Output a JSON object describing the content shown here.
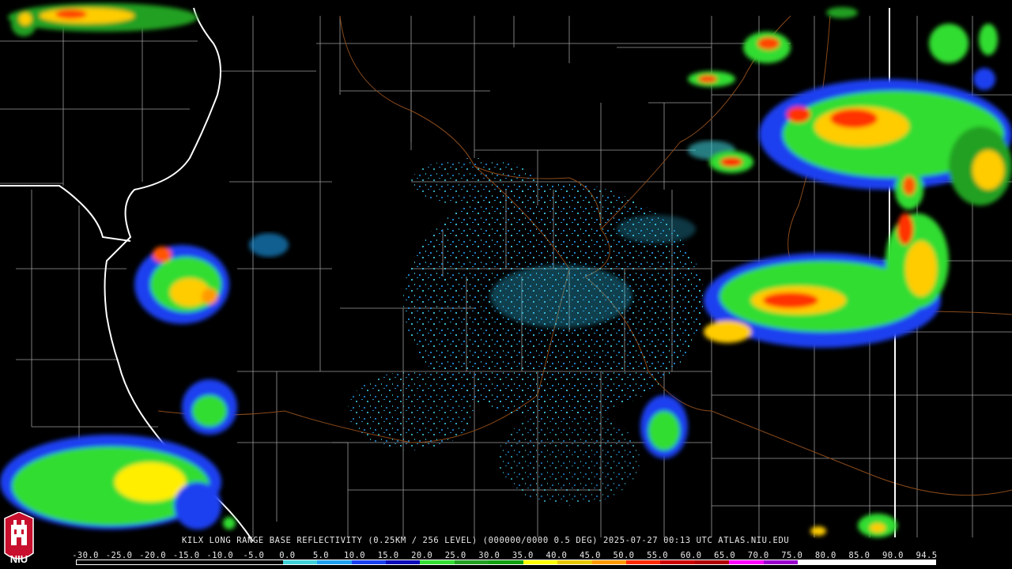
{
  "product": {
    "caption": "KILX LONG RANGE BASE REFLECTIVITY (0.25KM / 256 LEVEL) (000000/0000 0.5 DEG) 2025-07-27 00:13 UTC  ATLAS.NIU.EDU"
  },
  "legend": {
    "ticks": [
      "-30.0",
      "-25.0",
      "-20.0",
      "-15.0",
      "-10.0",
      "-5.0",
      "0.0",
      "5.0",
      "10.0",
      "15.0",
      "20.0",
      "25.0",
      "30.0",
      "35.0",
      "40.0",
      "45.0",
      "50.0",
      "55.0",
      "60.0",
      "65.0",
      "70.0",
      "75.0",
      "80.0",
      "85.0",
      "90.0",
      "94.5"
    ],
    "colors": [
      "#000000",
      "#000000",
      "#000000",
      "#000000",
      "#000000",
      "#000000",
      "#3fd0d8",
      "#1f9ff0",
      "#1a3ff0",
      "#0a0ab8",
      "#33dd33",
      "#22a022",
      "#10a010",
      "#ffff00",
      "#e8c800",
      "#ff9900",
      "#ff2a00",
      "#cc0000",
      "#b00000",
      "#ff00ff",
      "#9900cc",
      "#ffffff",
      "#ffffff",
      "#ffffff",
      "#ffffff"
    ]
  },
  "logo": {
    "text": "NIU",
    "color": "#c8102e"
  },
  "map_colors": {
    "background": "#000000",
    "county_lines": "#9a9a9a",
    "state_lines": "#ffffff",
    "rivers": "#8a4a1a"
  }
}
